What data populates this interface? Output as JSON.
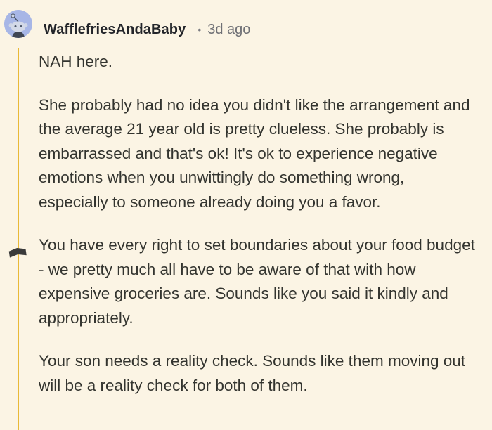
{
  "comment": {
    "username": "WafflefriesAndaBaby",
    "separator": "•",
    "timestamp": "3d ago",
    "avatar_icon": "snoo-avatar-icon",
    "thread_color": "#e9b937",
    "paragraphs": [
      "NAH here.",
      "She probably had no idea you didn't like the arrangement and the average 21 year old is pretty clueless. She probably is embarrassed and that's ok! It's ok to experience negative emotions when you unwittingly do something wrong, especially to someone already doing you a favor.",
      "You have every right to set boundaries about your food budget - we pretty much all have to be aware of that with how expensive groceries are. Sounds like you said it kindly and appropriately.",
      "Your son needs a reality check. Sounds like them moving out will be a reality check for both of them."
    ]
  }
}
